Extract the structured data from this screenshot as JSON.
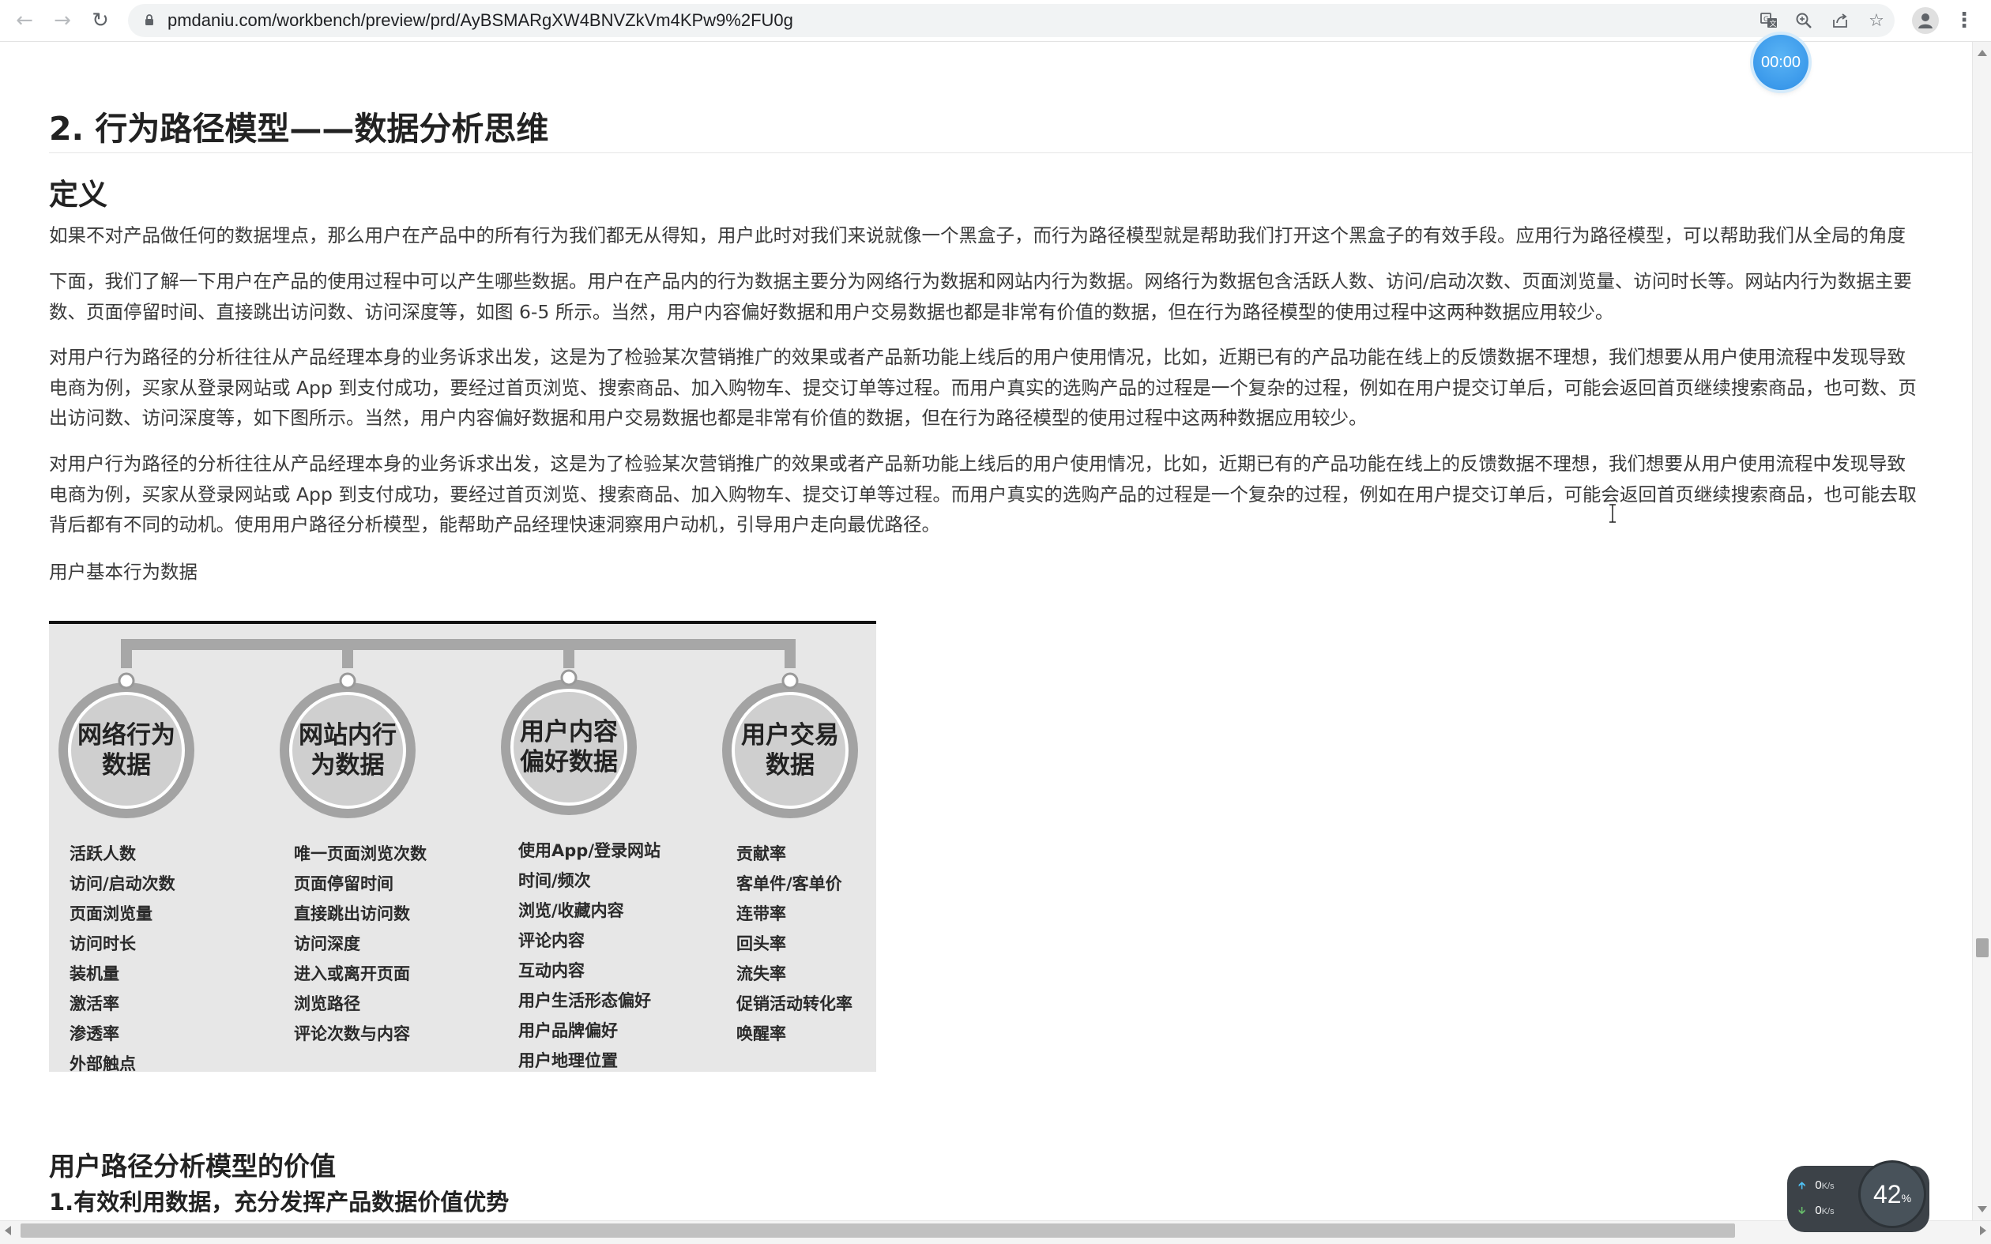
{
  "browser": {
    "url": "pmdaniu.com/workbench/preview/prd/AyBSMARgXW4BNVZkVm4KPw9%2FU0g",
    "icons": [
      "back-icon",
      "forward-icon",
      "reload-icon",
      "lock-icon",
      "translate-icon",
      "zoom-icon",
      "share-icon",
      "bookmark-star-icon",
      "profile-icon",
      "menu-icon"
    ]
  },
  "timer": {
    "label": "00:00"
  },
  "article": {
    "heading": "2. 行为路径模型——数据分析思维",
    "definition_heading": "定义",
    "paragraphs": [
      {
        "lines": [
          "如果不对产品做任何的数据埋点，那么用户在产品中的所有行为我们都无从得知，用户此时对我们来说就像一个黑盒子，而行为路径模型就是帮助我们打开这个黑盒子的有效手段。应用行为路径模型，可以帮助我们从全局的角度"
        ]
      },
      {
        "lines": [
          "下面，我们了解一下用户在产品的使用过程中可以产生哪些数据。用户在产品内的行为数据主要分为网络行为数据和网站内行为数据。网络行为数据包含活跃人数、访问/启动次数、页面浏览量、访问时长等。网站内行为数据主要",
          "数、页面停留时间、直接跳出访问数、访问深度等，如图 6-5 所示。当然，用户内容偏好数据和用户交易数据也都是非常有价值的数据，但在行为路径模型的使用过程中这两种数据应用较少。"
        ]
      },
      {
        "lines": [
          "对用户行为路径的分析往往从产品经理本身的业务诉求出发，这是为了检验某次营销推广的效果或者产品新功能上线后的用户使用情况，比如，近期已有的产品功能在线上的反馈数据不理想，我们想要从用户使用流程中发现导致",
          "电商为例，买家从登录网站或 App 到支付成功，要经过首页浏览、搜索商品、加入购物车、提交订单等过程。而用户真实的选购产品的过程是一个复杂的过程，例如在用户提交订单后，可能会返回首页继续搜索商品，也可数、页",
          "出访问数、访问深度等，如下图所示。当然，用户内容偏好数据和用户交易数据也都是非常有价值的数据，但在行为路径模型的使用过程中这两种数据应用较少。"
        ]
      },
      {
        "lines": [
          "对用户行为路径的分析往往从产品经理本身的业务诉求出发，这是为了检验某次营销推广的效果或者产品新功能上线后的用户使用情况，比如，近期已有的产品功能在线上的反馈数据不理想，我们想要从用户使用流程中发现导致",
          "电商为例，买家从登录网站或 App 到支付成功，要经过首页浏览、搜索商品、加入购物车、提交订单等过程。而用户真实的选购产品的过程是一个复杂的过程，例如在用户提交订单后，可能会返回首页继续搜索商品，也可能去取",
          "背后都有不同的动机。使用用户路径分析模型，能帮助产品经理快速洞察用户动机，引导用户走向最优路径。"
        ]
      }
    ],
    "figure_caption": "用户基本行为数据",
    "figure": {
      "categories": [
        {
          "title_line1": "网络行为",
          "title_line2": "数据",
          "items": [
            "活跃人数",
            "访问/启动次数",
            "页面浏览量",
            "访问时长",
            "装机量",
            "激活率",
            "渗透率",
            "外部触点"
          ]
        },
        {
          "title_line1": "网站内行",
          "title_line2": "为数据",
          "items": [
            "唯一页面浏览次数",
            "页面停留时间",
            "直接跳出访问数",
            "访问深度",
            "进入或离开页面",
            "浏览路径",
            "评论次数与内容"
          ]
        },
        {
          "title_line1": "用户内容",
          "title_line2": "偏好数据",
          "items": [
            "使用App/登录网站",
            "时间/频次",
            "浏览/收藏内容",
            "评论内容",
            "互动内容",
            "用户生活形态偏好",
            "用户品牌偏好",
            "用户地理位置"
          ]
        },
        {
          "title_line1": "用户交易",
          "title_line2": "数据",
          "items": [
            "贡献率",
            "客单件/客单价",
            "连带率",
            "回头率",
            "流失率",
            "促销活动转化率",
            "唤醒率"
          ]
        }
      ]
    },
    "section_heading": "用户路径分析模型的价值",
    "section_subheading": "1.有效利用数据，充分发挥产品数据价值优势"
  },
  "netmon": {
    "upload": "0",
    "upload_unit": "K/s",
    "download": "0",
    "download_unit": "K/s",
    "gauge_value": "42",
    "gauge_unit": "%"
  }
}
